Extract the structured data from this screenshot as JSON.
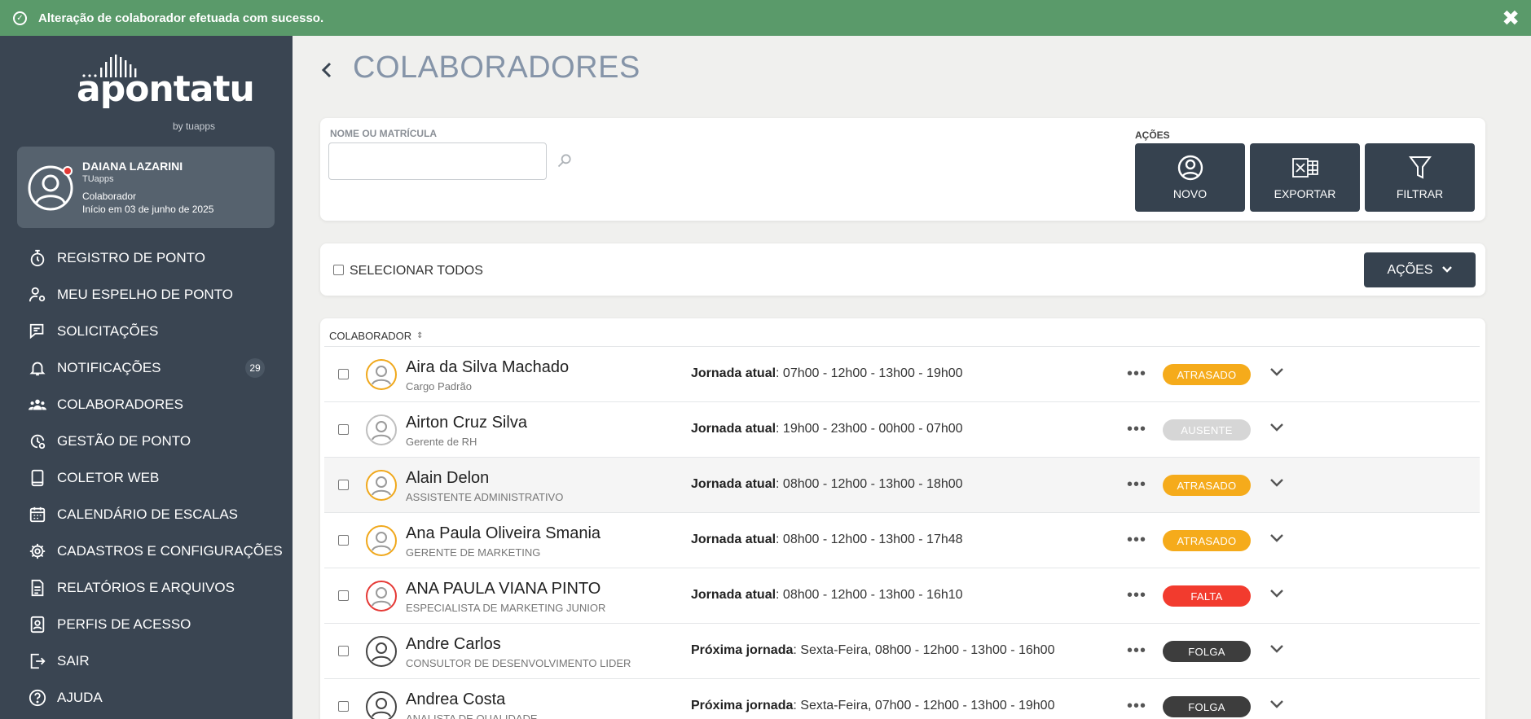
{
  "toast": {
    "message": "Alteração de colaborador efetuada com sucesso.",
    "close": "✖"
  },
  "sidebar": {
    "logo": {
      "word": "apontatu",
      "by": "by tuapps"
    },
    "user": {
      "name": "DAIANA LAZARINI",
      "company": "TUapps",
      "role": "Colaborador",
      "since": "Início em 03 de junho de 2025"
    },
    "items": [
      {
        "label": "REGISTRO DE PONTO",
        "icon": "stopwatch-icon"
      },
      {
        "label": "MEU ESPELHO DE PONTO",
        "icon": "user-gear-icon"
      },
      {
        "label": "SOLICITAÇÕES",
        "icon": "request-icon"
      },
      {
        "label": "NOTIFICAÇÕES",
        "icon": "bell-icon",
        "badge": "29"
      },
      {
        "label": "COLABORADORES",
        "icon": "users-icon"
      },
      {
        "label": "GESTÃO DE PONTO",
        "icon": "clock-gear-icon"
      },
      {
        "label": "COLETOR WEB",
        "icon": "tablet-icon"
      },
      {
        "label": "CALENDÁRIO DE ESCALAS",
        "icon": "calendar-icon"
      },
      {
        "label": "CADASTROS E CONFIGURAÇÕES",
        "icon": "gear-icon"
      },
      {
        "label": "RELATÓRIOS E ARQUIVOS",
        "icon": "document-icon"
      },
      {
        "label": "PERFIS DE ACESSO",
        "icon": "id-badge-icon"
      },
      {
        "label": "SAIR",
        "icon": "logout-icon"
      },
      {
        "label": "AJUDA",
        "icon": "help-icon"
      }
    ]
  },
  "page": {
    "title": "COLABORADORES"
  },
  "filters": {
    "name_label": "NOME OU MATRÍCULA",
    "name_value": "",
    "actions_label": "AÇÕES",
    "buttons": [
      {
        "label": "NOVO",
        "icon": "user-plus-icon"
      },
      {
        "label": "EXPORTAR",
        "icon": "excel-icon"
      },
      {
        "label": "FILTRAR",
        "icon": "filter-icon"
      }
    ]
  },
  "selectbar": {
    "select_all": "SELECIONAR TODOS",
    "actions": "AÇÕES"
  },
  "list": {
    "column": "COLABORADOR",
    "rows": [
      {
        "name": "Aira da Silva Machado",
        "role": "Cargo Padrão",
        "jour_label": "Jornada atual",
        "jour": ": 07h00 - 12h00  -  13h00 - 19h00",
        "status": "ATRASADO",
        "status_color": "#f5ab1b",
        "ring": "#f0a81c"
      },
      {
        "name": "Airton Cruz Silva",
        "role": "Gerente de RH",
        "jour_label": "Jornada atual",
        "jour": ": 19h00 - 23h00  -  00h00 - 07h00",
        "status": "AUSENTE",
        "status_color": "#d6d6d6",
        "ring": "#bfbfbf"
      },
      {
        "name": "Alain Delon",
        "role": "ASSISTENTE ADMINISTRATIVO",
        "jour_label": "Jornada atual",
        "jour": ": 08h00 - 12h00  -  13h00 - 18h00",
        "status": "ATRASADO",
        "status_color": "#f5ab1b",
        "ring": "#f0a81c"
      },
      {
        "name": "Ana Paula Oliveira Smania",
        "role": "GERENTE DE MARKETING",
        "jour_label": "Jornada atual",
        "jour": ": 08h00 - 12h00  -  13h00 - 17h48",
        "status": "ATRASADO",
        "status_color": "#f5ab1b",
        "ring": "#f0a81c"
      },
      {
        "name": "ANA PAULA VIANA PINTO",
        "role": "ESPECIALISTA DE MARKETING JUNIOR",
        "jour_label": "Jornada atual",
        "jour": ": 08h00 - 12h00  -  13h00 - 16h10",
        "status": "FALTA",
        "status_color": "#f23b2e",
        "ring": "#e53935"
      },
      {
        "name": "Andre Carlos",
        "role": "CONSULTOR DE DESENVOLVIMENTO LIDER",
        "jour_label": "Próxima jornada",
        "jour": ": Sexta-Feira, 08h00 - 12h00  -  13h00 - 16h00",
        "status": "FOLGA",
        "status_color": "#3d3d3d",
        "ring": "#444444"
      },
      {
        "name": "Andrea Costa",
        "role": "ANALISTA DE QUALIDADE",
        "jour_label": "Próxima jornada",
        "jour": ": Sexta-Feira, 07h00 - 12h00  -  13h00 - 19h00",
        "status": "FOLGA",
        "status_color": "#3d3d3d",
        "ring": "#444444"
      }
    ]
  }
}
